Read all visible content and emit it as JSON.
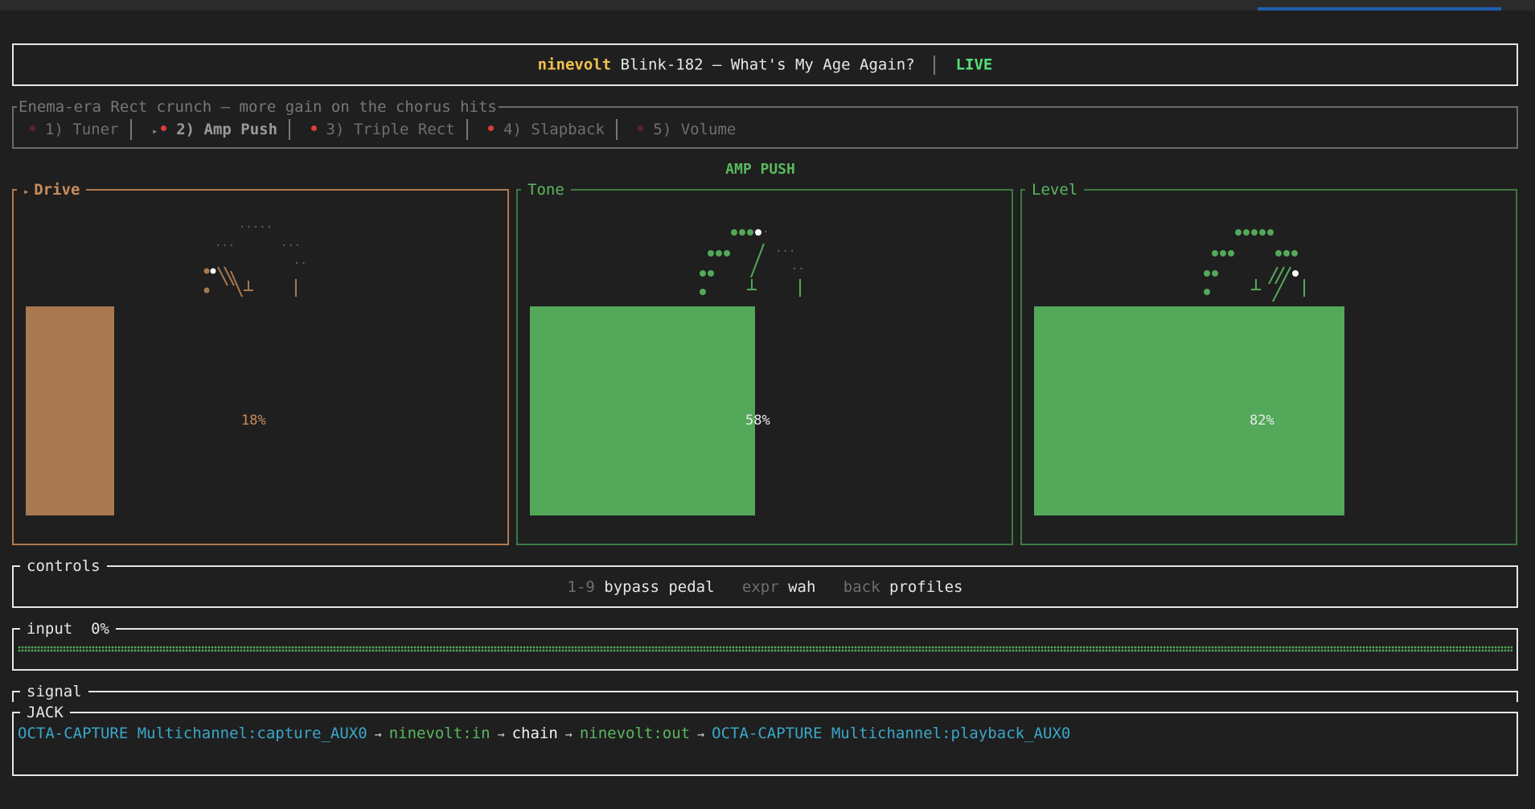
{
  "header": {
    "app": "ninevolt",
    "song": "Blink-182 — What's My Age Again?",
    "status": "LIVE"
  },
  "chain": {
    "description": "Enema-era Rect crunch — more gain on the chorus hits",
    "stages": [
      {
        "label": "1) Tuner",
        "on": false,
        "active": false,
        "dot_color": "#6b2a2a"
      },
      {
        "label": "2) Amp Push",
        "on": true,
        "active": true,
        "dot_color": "#e03a3a"
      },
      {
        "label": "3) Triple Rect",
        "on": true,
        "active": false,
        "dot_color": "#e03a3a"
      },
      {
        "label": "4) Slapback",
        "on": true,
        "active": false,
        "dot_color": "#e03a3a"
      },
      {
        "label": "5) Volume",
        "on": false,
        "active": false,
        "dot_color": "#6b2a2a"
      }
    ]
  },
  "section": {
    "title": "AMP PUSH"
  },
  "knobs": [
    {
      "name": "Drive",
      "value": 18,
      "pct": "18%",
      "focused": true,
      "color": "#a87850"
    },
    {
      "name": "Tone",
      "value": 58,
      "pct": "58%",
      "focused": false,
      "color": "#53a85a"
    },
    {
      "name": "Level",
      "value": 82,
      "pct": "82%",
      "focused": false,
      "color": "#53a85a"
    }
  ],
  "controls": {
    "title": "controls",
    "items": [
      {
        "key": "1-9",
        "action": "bypass pedal"
      },
      {
        "key": "expr",
        "action": "wah"
      },
      {
        "key": "back",
        "action": "profiles"
      }
    ]
  },
  "input": {
    "title": "input",
    "level": "0%"
  },
  "signal": {
    "title": "signal",
    "jack_title": "JACK",
    "route": {
      "capture": "OCTA-CAPTURE Multichannel:capture_AUX0",
      "in": "ninevolt:in",
      "chain": "chain",
      "out": "ninevolt:out",
      "playback": "OCTA-CAPTURE Multichannel:playback_AUX0"
    }
  }
}
